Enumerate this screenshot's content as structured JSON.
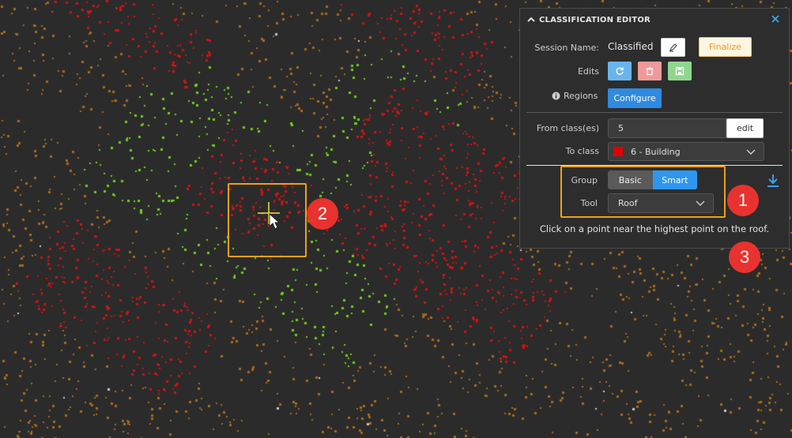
{
  "viewport": {
    "colors": {
      "ground": "#a86a1c",
      "vegetation": "#6ccf1c",
      "building": "#d21212",
      "unclassified": "#c8c8c8",
      "background": "#2b2b2b"
    }
  },
  "panel": {
    "title": "CLASSIFICATION EDITOR",
    "icons": {
      "collapse": "chevron-up-icon",
      "close": "close-icon",
      "rename": "pencil-icon",
      "refresh": "refresh-icon",
      "delete": "trash-icon",
      "save": "save-icon",
      "info": "info-icon",
      "download": "download-icon"
    },
    "session": {
      "label": "Session Name:",
      "value": "Classified",
      "finalize_label": "Finalize"
    },
    "edits": {
      "label": "Edits"
    },
    "regions": {
      "label": "Regions",
      "configure_label": "Configure"
    },
    "from_class": {
      "label": "From class(es)",
      "value": "5",
      "edit_label": "edit"
    },
    "to_class": {
      "label": "To class",
      "value": "6 - Building",
      "swatch_color": "#e00000"
    },
    "group": {
      "label": "Group",
      "options": [
        "Basic",
        "Smart"
      ],
      "selected": "Smart"
    },
    "tool": {
      "label": "Tool",
      "value": "Roof"
    },
    "hint": "Click on a point near the highest point on the roof."
  },
  "annotations": {
    "markers": [
      "1",
      "2",
      "3"
    ]
  }
}
